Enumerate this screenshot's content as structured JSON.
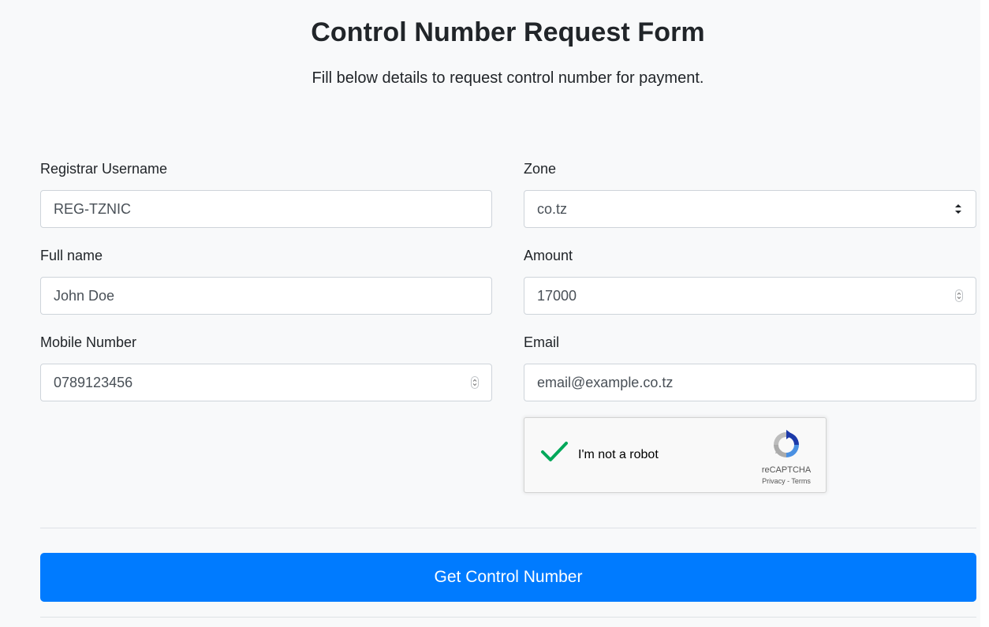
{
  "form": {
    "title": "Control Number Request Form",
    "subtitle": "Fill below details to request control number for payment.",
    "registrar_username": {
      "label": "Registrar Username",
      "value": "REG-TZNIC"
    },
    "zone": {
      "label": "Zone",
      "value": "co.tz"
    },
    "full_name": {
      "label": "Full name",
      "value": "John Doe"
    },
    "amount": {
      "label": "Amount",
      "value": "17000"
    },
    "mobile_number": {
      "label": "Mobile Number",
      "value": "0789123456"
    },
    "email": {
      "label": "Email",
      "placeholder": "email@example.co.tz"
    },
    "recaptcha": {
      "text": "I'm not a robot",
      "brand": "reCAPTCHA",
      "links": "Privacy - Terms",
      "checked": true
    },
    "submit_label": "Get Control Number"
  },
  "colors": {
    "page_background": "#f8f9fa",
    "primary": "#007bff",
    "check_green": "#00a85a",
    "input_border": "#ced4da"
  },
  "icons": {
    "zone_select": "select-caret-icon",
    "amount_spinner": "spinner-icon",
    "mobile_spinner": "spinner-icon",
    "captcha_check": "checkmark-icon",
    "captcha_logo": "recaptcha-logo-icon"
  }
}
